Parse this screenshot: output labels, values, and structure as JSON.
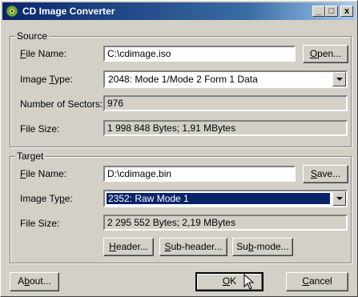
{
  "window": {
    "title": "CD Image Converter"
  },
  "titlebar_buttons": {
    "minimize": "_",
    "maximize": "□",
    "close": "x"
  },
  "source": {
    "legend": "Source",
    "file_name_label_k": "F",
    "file_name_label_rest": "ile Name:",
    "file_name_value": "C:\\cdimage.iso",
    "open_button_k": "O",
    "open_button_rest": "pen...",
    "image_type_label_pre": "Image ",
    "image_type_label_k": "T",
    "image_type_label_rest": "ype:",
    "image_type_value": "2048: Mode 1/Mode 2 Form 1 Data",
    "sectors_label": "Number of Sectors:",
    "sectors_value": "976",
    "file_size_label": "File Size:",
    "file_size_value": "1 998 848 Bytes; 1,91 MBytes"
  },
  "target": {
    "legend": "Target",
    "file_name_label_k": "F",
    "file_name_label_rest": "ile Name:",
    "file_name_value": "D:\\cdimage.bin",
    "save_button_k": "S",
    "save_button_rest": "ave...",
    "image_type_label_pre": "Image Ty",
    "image_type_label_k": "p",
    "image_type_label_rest": "e:",
    "image_type_value": "2352: Raw Mode 1",
    "file_size_label": "File Size:",
    "file_size_value": "2 295 552 Bytes; 2,19 MBytes",
    "header_button_k": "H",
    "header_button_rest": "eader...",
    "subheader_button_k": "S",
    "subheader_button_rest": "ub-header...",
    "submode_button_pre": "Su",
    "submode_button_k": "b",
    "submode_button_rest": "-mode..."
  },
  "footer": {
    "about_pre": "A",
    "about_k": "b",
    "about_rest": "out...",
    "ok_k": "O",
    "ok_rest": "K",
    "cancel_k": "C",
    "cancel_rest": "ancel"
  },
  "colors": {
    "titlebar_start": "#0a246a",
    "face": "#d4d0c8",
    "selection": "#0a246a"
  }
}
